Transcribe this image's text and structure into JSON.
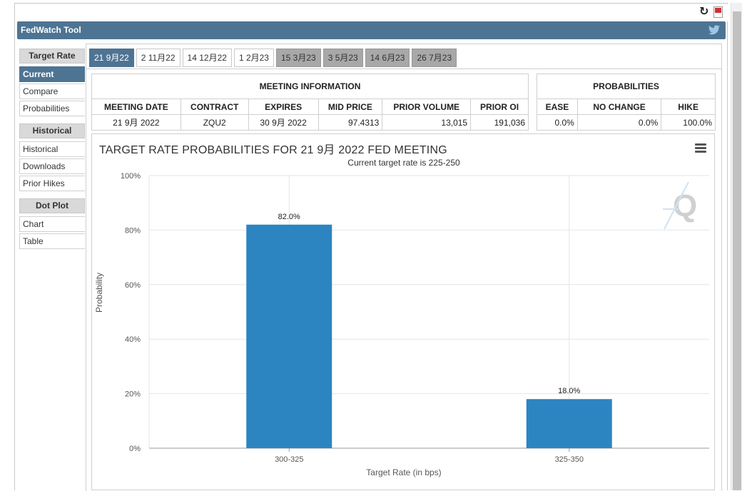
{
  "app": {
    "title": "FedWatch Tool"
  },
  "toolbar": {
    "refresh_icon": "refresh-icon",
    "pdf_icon": "pdf-icon"
  },
  "sidebar": {
    "sections": [
      {
        "heading": "Target Rate",
        "items": [
          "Current",
          "Compare",
          "Probabilities"
        ]
      },
      {
        "heading": "Historical",
        "items": [
          "Historical",
          "Downloads",
          "Prior Hikes"
        ]
      },
      {
        "heading": "Dot Plot",
        "items": [
          "Chart",
          "Table"
        ]
      }
    ],
    "active_item": "Current"
  },
  "tabs": [
    "21 9月22",
    "2 11月22",
    "14 12月22",
    "1 2月23",
    "15 3月23",
    "3 5月23",
    "14 6月23",
    "26 7月23"
  ],
  "tabs_active_index": 0,
  "tabs_grey_from_index": 4,
  "meeting_info": {
    "heading": "MEETING INFORMATION",
    "columns": [
      "MEETING DATE",
      "CONTRACT",
      "EXPIRES",
      "MID PRICE",
      "PRIOR VOLUME",
      "PRIOR OI"
    ],
    "values": [
      "21 9月 2022",
      "ZQU2",
      "30 9月 2022",
      "97.4313",
      "13,015",
      "191,036"
    ]
  },
  "probabilities": {
    "heading": "PROBABILITIES",
    "columns": [
      "EASE",
      "NO CHANGE",
      "HIKE"
    ],
    "values": [
      "0.0%",
      "0.0%",
      "100.0%"
    ]
  },
  "colors": {
    "accent": "#4e7493",
    "bar": "#2c85c0",
    "grey_tab": "#a8a8a8"
  },
  "chart_data": {
    "type": "bar",
    "title": "TARGET RATE PROBABILITIES FOR 21 9月 2022 FED MEETING",
    "subtitle": "Current target rate is 225-250",
    "categories": [
      "300-325",
      "325-350"
    ],
    "values": [
      82.0,
      18.0
    ],
    "data_labels": [
      "82.0%",
      "18.0%"
    ],
    "xlabel": "Target Rate (in bps)",
    "ylabel": "Probability",
    "ylim": [
      0,
      100
    ],
    "yticks": [
      "0%",
      "20%",
      "40%",
      "60%",
      "80%",
      "100%"
    ],
    "grid": true,
    "legend": "none"
  }
}
